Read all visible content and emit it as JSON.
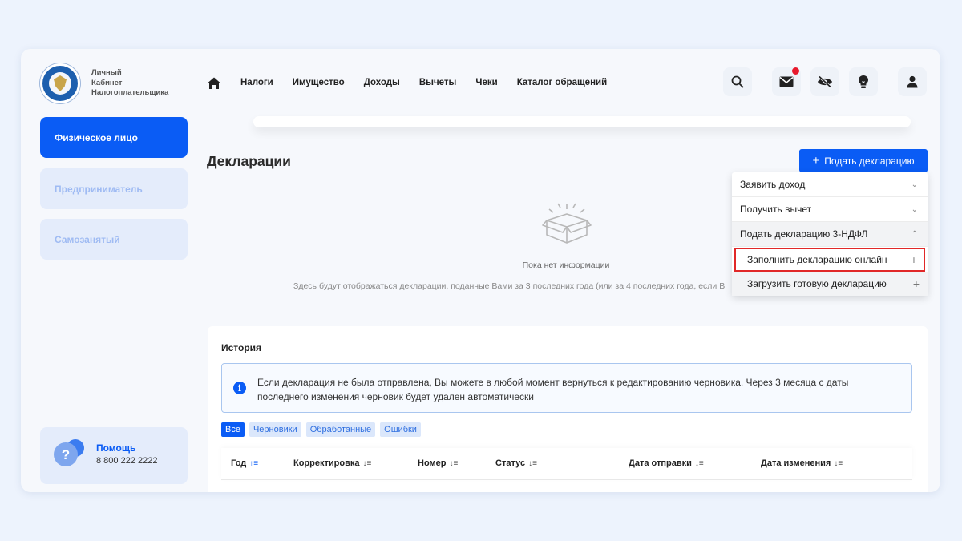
{
  "brand": {
    "line1": "Личный",
    "line2": "Кабинет",
    "line3": "Налогоплательщика"
  },
  "nav": [
    "Налоги",
    "Имущество",
    "Доходы",
    "Вычеты",
    "Чеки",
    "Каталог обращений"
  ],
  "sidebar": {
    "items": [
      {
        "label": "Физическое лицо",
        "active": true
      },
      {
        "label": "Предприниматель",
        "active": false
      },
      {
        "label": "Самозанятый",
        "active": false
      }
    ],
    "help": {
      "title": "Помощь",
      "phone": "8 800 222 2222"
    }
  },
  "main": {
    "title": "Декларации",
    "submit_button": "Подать декларацию",
    "empty_title": "Пока нет информации",
    "empty_desc": "Здесь будут отображаться декларации, поданные Вами за 3 последних года (или за 4 последних года, если В"
  },
  "dropdown": {
    "items": [
      {
        "label": "Заявить доход",
        "state": "collapsed"
      },
      {
        "label": "Получить вычет",
        "state": "collapsed"
      },
      {
        "label": "Подать декларацию 3-НДФЛ",
        "state": "expanded"
      }
    ],
    "subitems": [
      {
        "label": "Заполнить декларацию онлайн",
        "highlighted": true
      },
      {
        "label": "Загрузить готовую декларацию",
        "highlighted": false
      }
    ]
  },
  "history": {
    "title": "История",
    "info": "Если декларация не была отправлена, Вы можете в любой момент вернуться к редактированию черновика. Через 3 месяца с даты последнего изменения черновик будет удален автоматически",
    "filters": [
      "Все",
      "Черновики",
      "Обработанные",
      "Ошибки"
    ],
    "active_filter": "Все",
    "columns": [
      "Год",
      "Корректировка",
      "Номер",
      "Статус",
      "Дата отправки",
      "Дата изменения"
    ]
  },
  "colors": {
    "accent": "#0a5cf5",
    "notification": "#e8192c",
    "highlight_border": "#e12828"
  }
}
